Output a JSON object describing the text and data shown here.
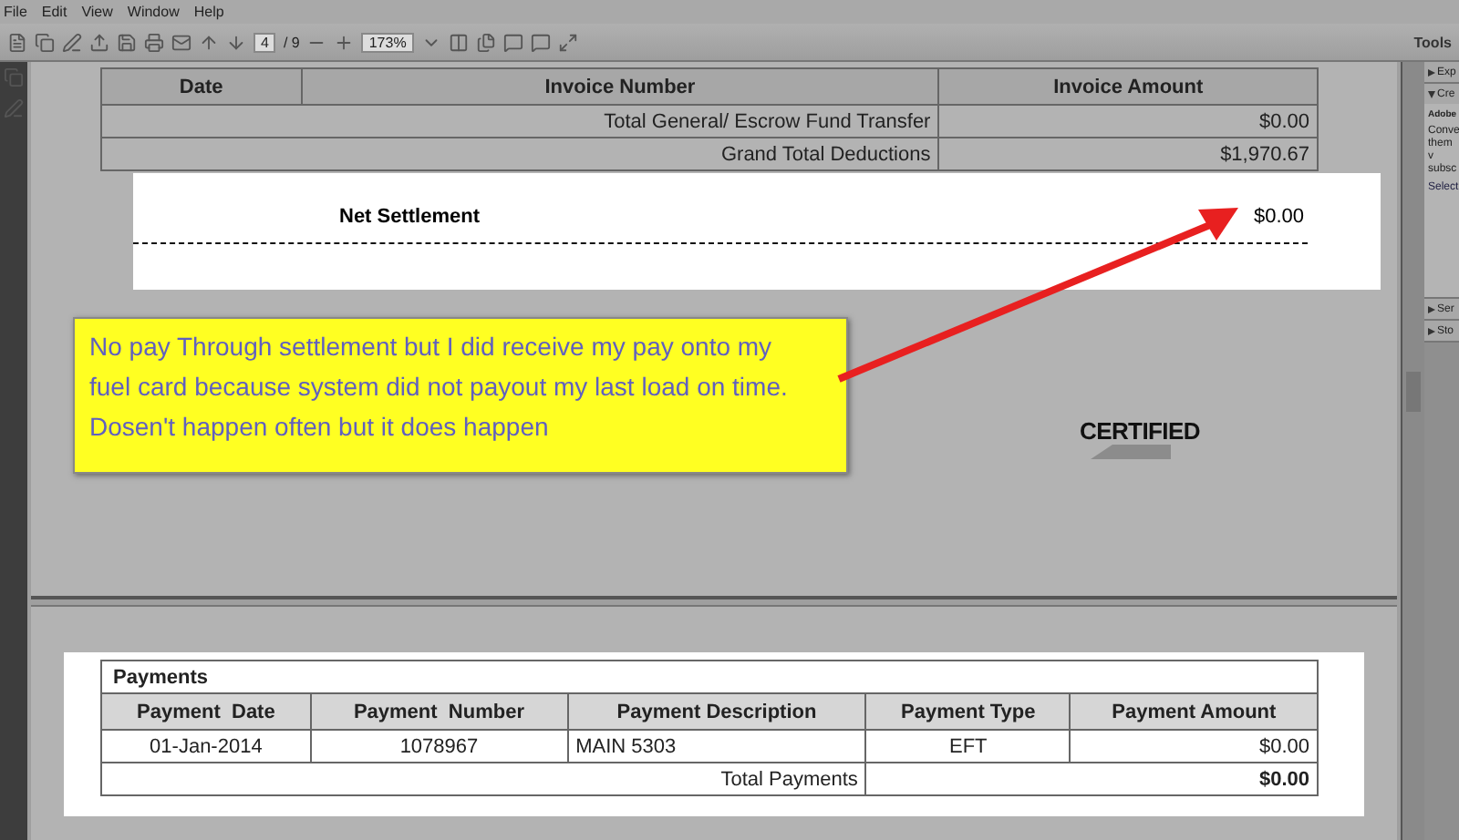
{
  "menu": [
    "File",
    "Edit",
    "View",
    "Window",
    "Help"
  ],
  "toolbar": {
    "page_field": "4",
    "page_count": "/ 9",
    "zoom": "173%",
    "tools": "Tools"
  },
  "invoice_table": {
    "columns": [
      "Date",
      "Invoice Number",
      "Invoice Amount"
    ],
    "rows": [
      {
        "label": "Total General/ Escrow Fund Transfer",
        "amount": "$0.00"
      },
      {
        "label": "Grand Total Deductions",
        "amount": "$1,970.67"
      }
    ]
  },
  "net_settlement": {
    "label": "Net Settlement",
    "amount": "$0.00"
  },
  "annotation": "No pay Through settlement but I did receive my pay onto my fuel card because system did not payout my last load on time. Dosen't happen often but it does happen",
  "stamp": "CERTIFIED",
  "payments": {
    "title": "Payments",
    "columns": [
      "Payment  Date",
      "Payment  Number",
      "Payment Description",
      "Payment Type",
      "Payment Amount"
    ],
    "rows": [
      [
        "01-Jan-2014",
        "1078967",
        "MAIN 5303",
        "EFT",
        "$0.00"
      ]
    ],
    "total": {
      "label": "Total Payments",
      "amount": "$0.00"
    }
  },
  "right_panel": {
    "sections": [
      {
        "label": "Exp",
        "expanded": false
      },
      {
        "label": "Cre",
        "expanded": true,
        "heading": "Adobe",
        "note": "Conve them v subsc",
        "link": "Select"
      },
      {
        "label": "Ser",
        "expanded": false
      },
      {
        "label": "Sto",
        "expanded": false
      }
    ]
  }
}
